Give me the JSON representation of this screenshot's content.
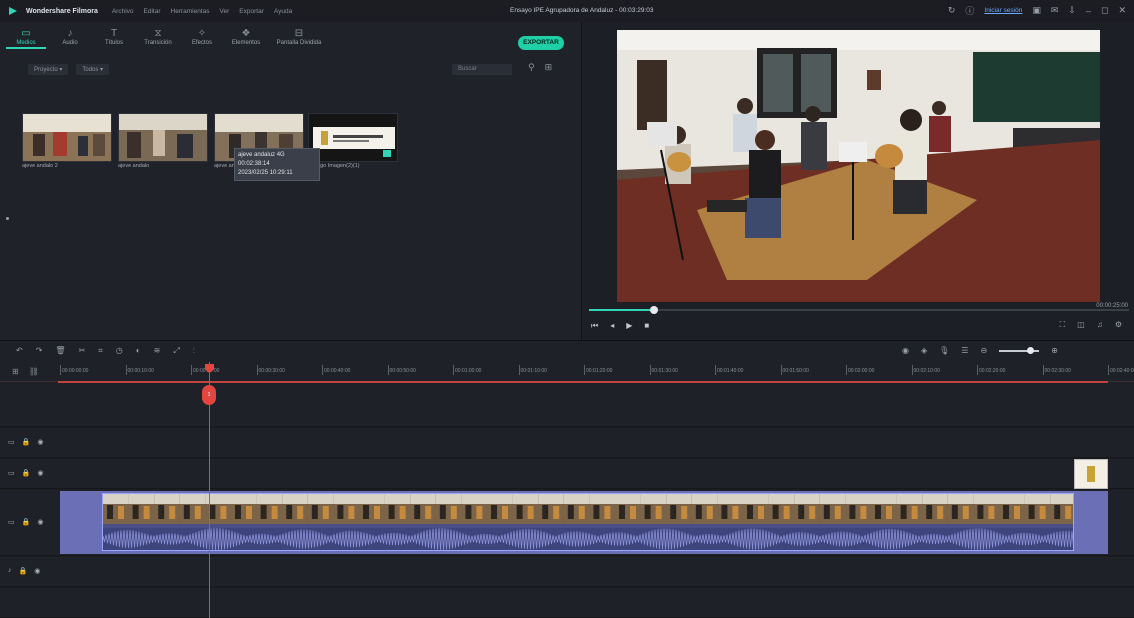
{
  "titlebar": {
    "app_name": "Wondershare Filmora",
    "menu": [
      "Archivo",
      "Editar",
      "Herramientas",
      "Ver",
      "Exportar",
      "Ayuda"
    ],
    "project_title": "Ensayo IPE Agrupadora de Andaluz - 00:03:29:03",
    "login_link": "Iniciar sesión"
  },
  "media": {
    "tabs": [
      {
        "label": "Medios",
        "icon": "folder-icon"
      },
      {
        "label": "Audio",
        "icon": "music-icon"
      },
      {
        "label": "Títulos",
        "icon": "text-icon"
      },
      {
        "label": "Transición",
        "icon": "transition-icon"
      },
      {
        "label": "Efectos",
        "icon": "effects-icon"
      },
      {
        "label": "Elementos",
        "icon": "elements-icon"
      },
      {
        "label": "Pantalla Dividida",
        "icon": "split-icon"
      }
    ],
    "export_label": "EXPORTAR",
    "filter_project": "Proyecto",
    "filter_all": "Todos",
    "search_placeholder": "Buscar",
    "items": [
      {
        "label": "ajeve andalo 2"
      },
      {
        "label": "ajeve andalo"
      },
      {
        "label": "ajeve andalo"
      },
      {
        "label": "Logo Imagen(2)(1)"
      }
    ],
    "tooltip": {
      "line1": "ajeve andaluz 4G",
      "line2": "00:02:38:14",
      "line3": "2023/02/25 10:29:11"
    }
  },
  "preview": {
    "timecode": "00:00:25:00",
    "progress": 0.12
  },
  "ruler": {
    "ticks": [
      "00:00:00:00",
      "00:00:10:00",
      "00:00:20:00",
      "00:00:30:00",
      "00:00:40:00",
      "00:00:50:00",
      "00:01:00:00",
      "00:01:10:00",
      "00:01:20:00",
      "00:01:30:00",
      "00:01:40:00",
      "00:01:50:00",
      "00:02:00:00",
      "00:02:10:00",
      "00:02:20:00",
      "00:02:30:00",
      "00:02:40:00"
    ]
  },
  "timeline": {
    "playhead_badge": "1"
  }
}
